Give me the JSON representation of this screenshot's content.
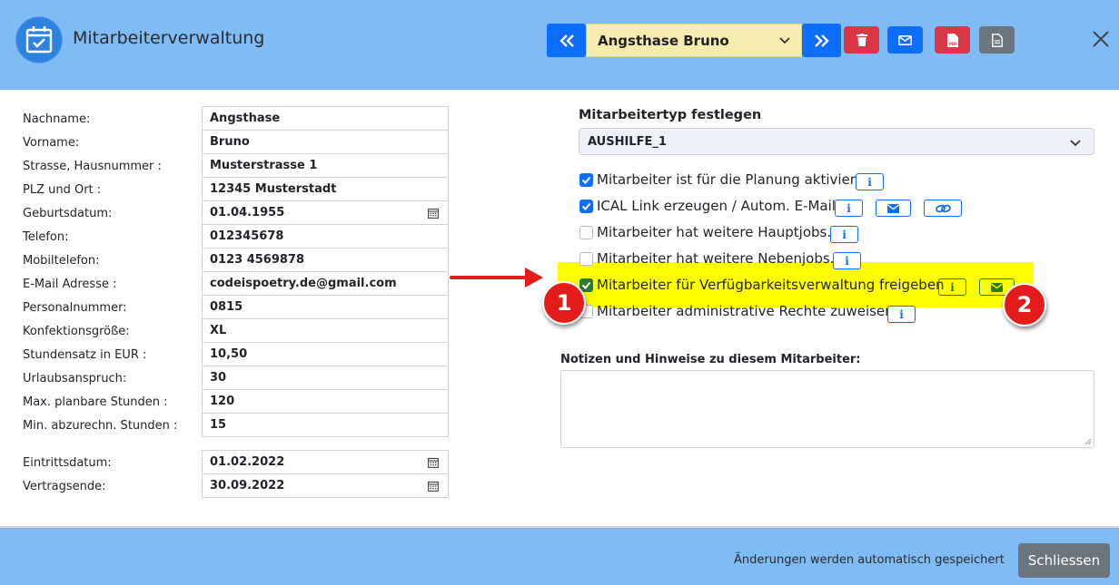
{
  "header": {
    "title": "Mitarbeiterverwaltung",
    "selected_employee": "Angsthase Bruno",
    "colors": {
      "header_bg": "#7fbbf5",
      "nav_blue": "#0d6efd",
      "delete_red": "#dc3545",
      "pdf_red": "#dc3545",
      "doc_gray": "#6c757d",
      "select_yellow": "#f7ecb0"
    },
    "icons": [
      "calendar-check-icon",
      "double-chevron-left-icon",
      "chevron-down-icon",
      "double-chevron-right-icon",
      "trash-icon",
      "envelope-icon",
      "pdf-icon",
      "document-icon",
      "close-icon"
    ]
  },
  "form": {
    "fields": [
      {
        "label": "Nachname:",
        "value": "Angsthase"
      },
      {
        "label": "Vorname:",
        "value": "Bruno"
      },
      {
        "label": "Strasse, Hausnummer :",
        "value": "Musterstrasse 1"
      },
      {
        "label": "PLZ und Ort :",
        "value": "12345 Musterstadt"
      },
      {
        "label": "Geburtsdatum:",
        "value": "01.04.1955"
      },
      {
        "label": "Telefon:",
        "value": "012345678"
      },
      {
        "label": "Mobiltelefon:",
        "value": "0123 4569878"
      },
      {
        "label": "E-Mail Adresse :",
        "value": "codeispoetry.de@gmail.com"
      },
      {
        "label": "Personalnummer:",
        "value": "0815"
      },
      {
        "label": "Konfektionsgröße:",
        "value": "XL"
      },
      {
        "label": "Stundensatz in EUR :",
        "value": "10,50"
      },
      {
        "label": "Urlaubsanspruch:",
        "value": "30"
      },
      {
        "label": "Max. planbare Stunden :",
        "value": "120"
      },
      {
        "label": "Min. abzurechn. Stunden :",
        "value": "15"
      }
    ],
    "dates": [
      {
        "label": "Eintrittsdatum:",
        "value": "01.02.2022"
      },
      {
        "label": "Vertragsende:",
        "value": "30.09.2022"
      }
    ]
  },
  "employee_type": {
    "title": "Mitarbeitertyp festlegen",
    "selected": "AUSHILFE_1"
  },
  "options": [
    {
      "label": "Mitarbeiter ist für die Planung aktiviert",
      "checked": true
    },
    {
      "label": "ICAL Link erzeugen / Autom. E-Mail",
      "checked": true
    },
    {
      "label": "Mitarbeiter hat weitere Hauptjobs.",
      "checked": false
    },
    {
      "label": "Mitarbeiter hat weitere Nebenjobs.",
      "checked": false
    },
    {
      "label": "Mitarbeiter für Verfügbarkeitsverwaltung freigeben",
      "checked": true
    },
    {
      "label": "Mitarbeiter administrative Rechte zuweisen",
      "checked": false
    }
  ],
  "annotations": {
    "badge_1": "1",
    "badge_2": "2",
    "highlight_color": "#ffff00",
    "arrow_color": "#e31b1b"
  },
  "notes": {
    "label": "Notizen und Hinweise zu diesem Mitarbeiter:",
    "value": ""
  },
  "footer": {
    "autosave_text": "Änderungen werden automatisch gespeichert",
    "close_label": "Schliessen"
  }
}
